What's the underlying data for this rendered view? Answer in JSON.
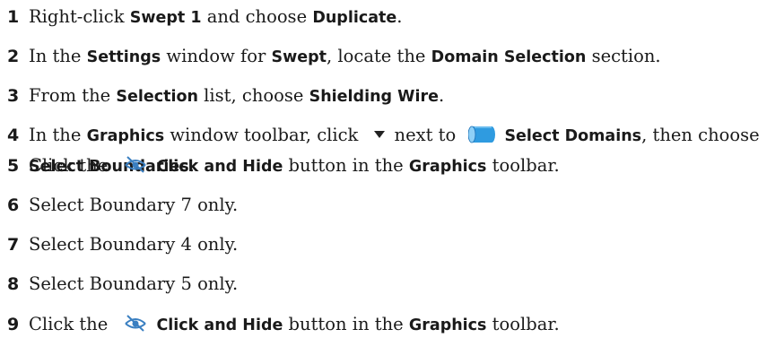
{
  "steps": [
    {
      "num": "1",
      "parts": [
        {
          "t": "Right-click "
        },
        {
          "b": "Swept 1"
        },
        {
          "t": " and choose "
        },
        {
          "b": "Duplicate"
        },
        {
          "t": "."
        }
      ]
    },
    {
      "num": "2",
      "parts": [
        {
          "t": "In the "
        },
        {
          "b": "Settings"
        },
        {
          "t": " window for "
        },
        {
          "b": "Swept"
        },
        {
          "t": ", locate the "
        },
        {
          "b": "Domain Selection"
        },
        {
          "t": " section."
        }
      ]
    },
    {
      "num": "3",
      "parts": [
        {
          "t": "From the "
        },
        {
          "b": "Selection"
        },
        {
          "t": " list, choose "
        },
        {
          "b": "Shielding Wire"
        },
        {
          "t": "."
        }
      ]
    },
    {
      "num": "4",
      "parts": [
        {
          "t": "In the "
        },
        {
          "b": "Graphics"
        },
        {
          "t": " window toolbar, click "
        },
        {
          "icon": "dropdown-triangle-icon"
        },
        {
          "t": "next to "
        },
        {
          "icon": "select-domains-icon"
        },
        {
          "b": "Select Domains"
        },
        {
          "t": ", then choose"
        }
      ],
      "line2": [
        {
          "b": "Select Boundaries"
        },
        {
          "t": "."
        }
      ]
    },
    {
      "num": "5",
      "parts": [
        {
          "t": "Click the "
        },
        {
          "icon": "click-and-hide-icon"
        },
        {
          "b": "Click and Hide"
        },
        {
          "t": " button in the "
        },
        {
          "b": "Graphics"
        },
        {
          "t": " toolbar."
        }
      ]
    },
    {
      "num": "6",
      "parts": [
        {
          "t": "Select Boundary 7 only."
        }
      ]
    },
    {
      "num": "7",
      "parts": [
        {
          "t": "Select Boundary 4 only."
        }
      ]
    },
    {
      "num": "8",
      "parts": [
        {
          "t": "Select Boundary 5 only."
        }
      ]
    },
    {
      "num": "9",
      "parts": [
        {
          "t": "Click the "
        },
        {
          "icon": "click-and-hide-icon"
        },
        {
          "b": "Click and Hide"
        },
        {
          "t": " button in the "
        },
        {
          "b": "Graphics"
        },
        {
          "t": " toolbar."
        }
      ]
    }
  ],
  "colors": {
    "text": "#1a1a1a",
    "domains_icon_fill": "#2f9be0",
    "domains_icon_edge": "#1a6fb5",
    "hide_icon_color": "#3a7fc1"
  }
}
